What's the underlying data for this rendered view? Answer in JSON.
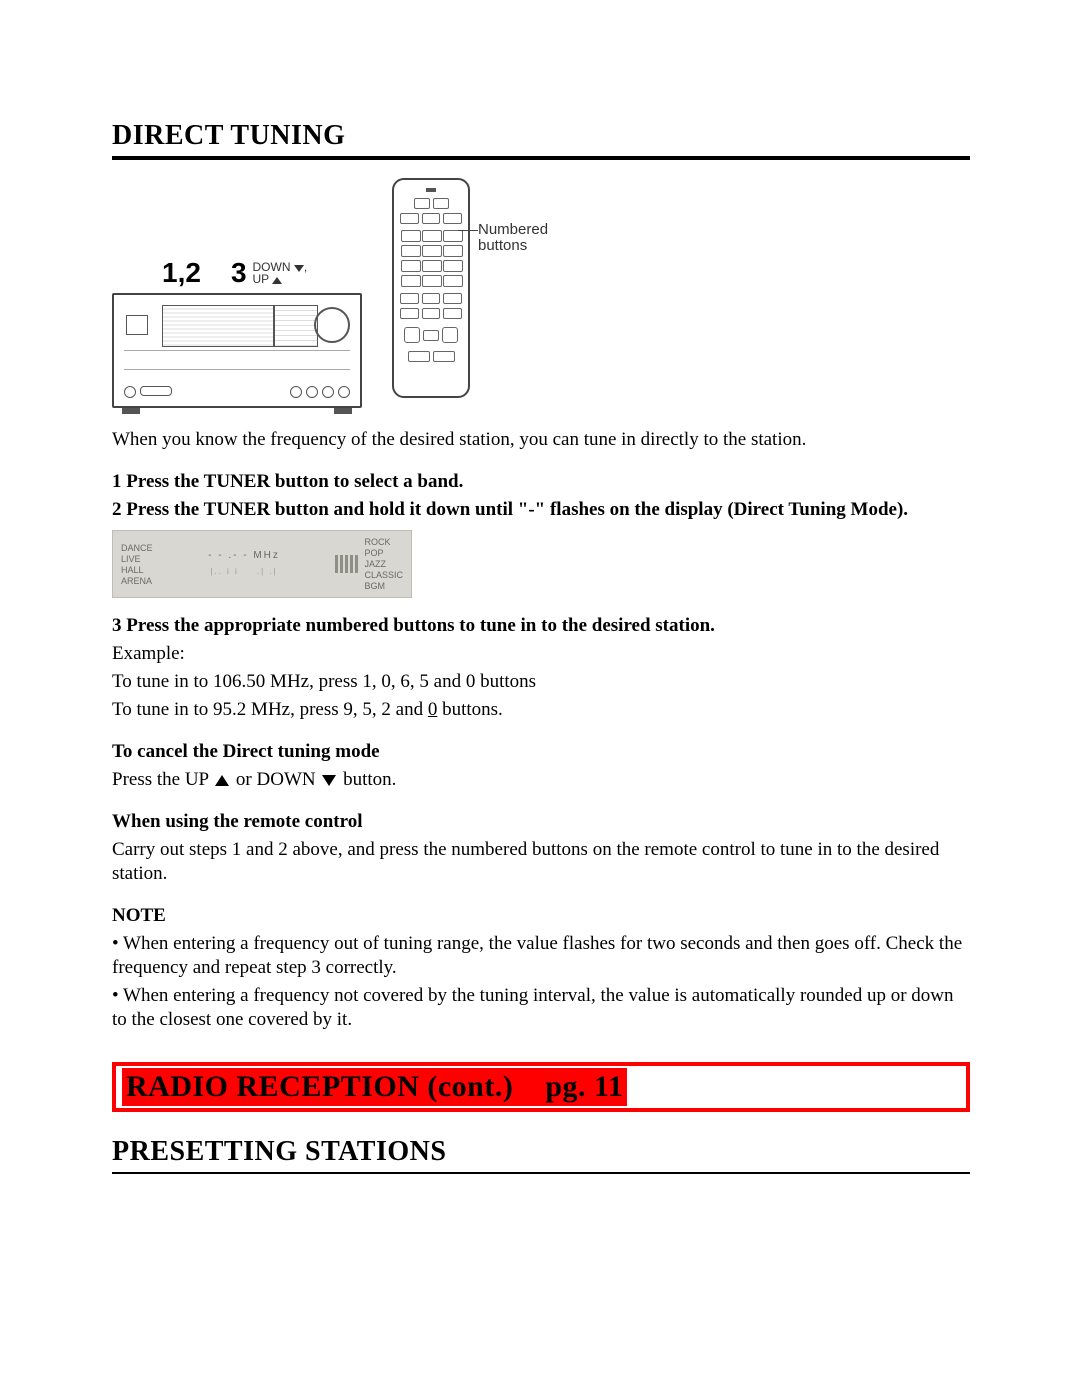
{
  "section1": {
    "title": "DIRECT TUNING",
    "figure": {
      "label_12": "1,2",
      "label_3": "3",
      "down": "DOWN",
      "up": "UP",
      "remote_label_l1": "Numbered",
      "remote_label_l2": "buttons"
    },
    "intro": "When you know the frequency of the desired station, you can tune in directly to the station.",
    "step1": "1 Press the TUNER button to select a band.",
    "step2": "2 Press the TUNER button and hold it down until \"-\" flashes on the display (Direct Tuning Mode).",
    "lcd": {
      "left": [
        "DANCE",
        "LIVE",
        "HALL",
        "ARENA"
      ],
      "mhz": "- - .- - MHz",
      "right": [
        "ROCK",
        "POP",
        "JAZZ",
        "CLASSIC",
        "BGM"
      ]
    },
    "step3": "3 Press the appropriate numbered buttons to tune in to the desired station.",
    "example_label": "Example:",
    "example1": "To tune in to 106.50 MHz, press 1, 0, 6, 5 and 0 buttons",
    "example2_a": "To tune in to 95.2 MHz, press 9, 5, 2 and ",
    "example2_underlined": "0",
    "example2_b": " buttons.",
    "cancel_head": "To cancel the Direct tuning mode",
    "cancel_body_a": "Press the UP ",
    "cancel_body_b": " or DOWN ",
    "cancel_body_c": "  button.",
    "remote_head": "When using the remote control",
    "remote_body": "Carry out steps 1 and 2 above, and press the numbered buttons on the remote control to tune in to the desired station.",
    "note_head": "NOTE",
    "note1": "• When entering a frequency out of tuning range, the value flashes for two seconds and then goes off.  Check the frequency and repeat step 3 correctly.",
    "note2": "• When entering a frequency not covered by the tuning interval, the value is automatically rounded up or down to the closest one covered by it."
  },
  "callout": {
    "text": "RADIO RECEPTION (cont.)    pg. 11"
  },
  "section2": {
    "title": "PRESETTING STATIONS"
  }
}
